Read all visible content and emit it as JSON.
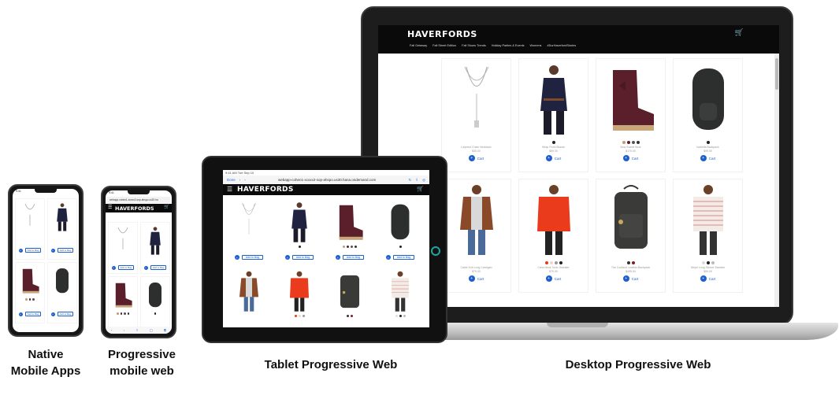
{
  "brand": "HAVERFORDS",
  "colors": {
    "accent_blue": "#1e5fd0",
    "header_black": "#0a0a0a",
    "device_frame": "#161616",
    "tablet_home_ring": "#1ba6a6"
  },
  "icons": {
    "cart": "shopping-cart-icon",
    "menu": "hamburger-menu-icon",
    "add": "add-circle-icon"
  },
  "captions": {
    "native": "Native Mobile Apps",
    "pwa": "Progressive mobile web",
    "tablet": "Tablet Progressive Web",
    "desktop": "Desktop Progressive Web"
  },
  "desktop": {
    "cart_icon": "🛒",
    "nav": [
      "Fall Getaway",
      "Fall Street Edition",
      "Fall Shoes Trends",
      "Holiday Parties & Events",
      "Womens",
      "#DurHaverfordStories"
    ],
    "cart_label": "Cart",
    "products": [
      {
        "name": "Layered Chain Necklace",
        "price": "$45.00"
      },
      {
        "name": "Wrap Front Blouse",
        "price": "$89.00"
      },
      {
        "name": "Bow Suede Boot",
        "price": "$170.00"
      },
      {
        "name": "Isabella Backpack",
        "price": "$99.00"
      },
      {
        "name": "Cable Knit Long Cardigan",
        "price": "$79.00"
      },
      {
        "name": "Crew Neck Tunic Sweater",
        "price": "$79.00"
      },
      {
        "name": "The Cortland Leather Backpack",
        "price": "$495.00"
      },
      {
        "name": "Stripe Long Sleeve Sweater",
        "price": "$59.00"
      }
    ]
  },
  "tablet": {
    "status": "9:41 AM  Tue Sep 10",
    "done": "Done",
    "url": "webapp-cohen1-xcxxx2-sop-ahspo.us30.hana.ondemand.com",
    "menu": "☰",
    "cart_icon": "🛒",
    "cart_button": "Add to Bag"
  },
  "phone_native": {
    "status": "9:41",
    "cart_button": "Add to Bag"
  },
  "phone_pwa": {
    "status": "9:41",
    "url": "webapp-cohen1-xcxxx2-sop-ahspo.us30.ha",
    "menu": "☰",
    "cart_icon": "🛒",
    "cart_button": "Add to Bag",
    "toolbar": [
      "‹",
      "›",
      "⇪",
      "▢",
      "⧉"
    ]
  }
}
